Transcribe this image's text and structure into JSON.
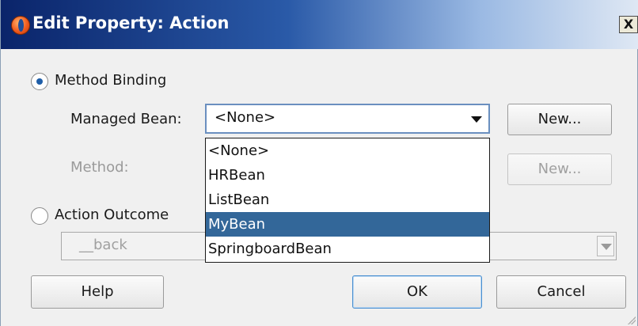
{
  "window": {
    "title": "Edit Property: Action",
    "close_label": "X"
  },
  "method_binding": {
    "radio_label": "Method Binding",
    "selected": true,
    "managed_bean_label": "Managed Bean:",
    "managed_bean_value": "<None>",
    "new_bean_button": "New...",
    "method_label": "Method:",
    "new_method_button": "New..."
  },
  "action_outcome": {
    "radio_label": "Action Outcome",
    "selected": false,
    "value": "__back"
  },
  "dropdown": {
    "open": true,
    "items": [
      "<None>",
      "HRBean",
      "ListBean",
      "MyBean",
      "SpringboardBean"
    ],
    "highlighted": "MyBean"
  },
  "footer": {
    "help_button": "Help",
    "ok_button": "OK",
    "cancel_button": "Cancel"
  },
  "colors": {
    "title_gradient_start": "#0a246a",
    "selection": "#336799",
    "radio_dot": "#1f5ea8"
  }
}
